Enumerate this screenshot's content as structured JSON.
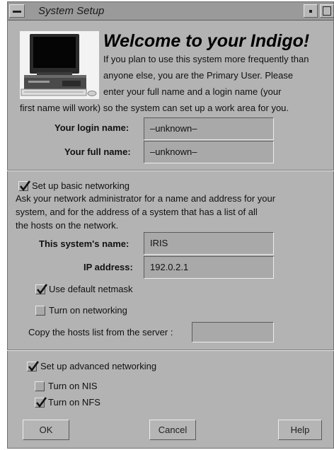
{
  "window": {
    "title": "System Setup"
  },
  "welcome": {
    "heading": "Welcome to your Indigo!",
    "lines": [
      "If you plan to use this system more frequently than",
      "anyone else,  you are the Primary User.  Please",
      "enter your full name and a login name (your",
      "first name will work) so the system can set up a work area for you."
    ]
  },
  "user": {
    "login_label": "Your login name:",
    "login_value": "–unknown–",
    "fullname_label": "Your full name:",
    "fullname_value": "–unknown–"
  },
  "basic_networking": {
    "checkbox_label": "Set up basic networking",
    "checked": true,
    "description": [
      "Ask your network administrator for a name and address for your",
      "system, and for the address of a system that has a list of all",
      "the hosts on the network."
    ],
    "system_name_label": "This system's name:",
    "system_name_value": "IRIS",
    "ip_label": "IP address:",
    "ip_value": "192.0.2.1",
    "default_netmask_label": "Use default netmask",
    "default_netmask_checked": true,
    "turn_on_networking_label": "Turn on networking",
    "turn_on_networking_checked": false,
    "hosts_label": "Copy the hosts list from the server :",
    "hosts_value": ""
  },
  "advanced_networking": {
    "checkbox_label": "Set up advanced networking",
    "checked": true,
    "nis_label": "Turn on NIS",
    "nis_checked": false,
    "nfs_label": "Turn on NFS",
    "nfs_checked": true
  },
  "buttons": {
    "ok": "OK",
    "cancel": "Cancel",
    "help": "Help"
  },
  "icons": {
    "window_menu": "window-menu-icon",
    "minimize": "minimize-icon",
    "maximize": "maximize-icon",
    "computer": "indigo-workstation-icon",
    "checkmark": "checkmark-icon"
  },
  "colors": {
    "background": "#b3b3b3",
    "titlebar": "#9a9a9a",
    "field": "#a9a9a9"
  }
}
